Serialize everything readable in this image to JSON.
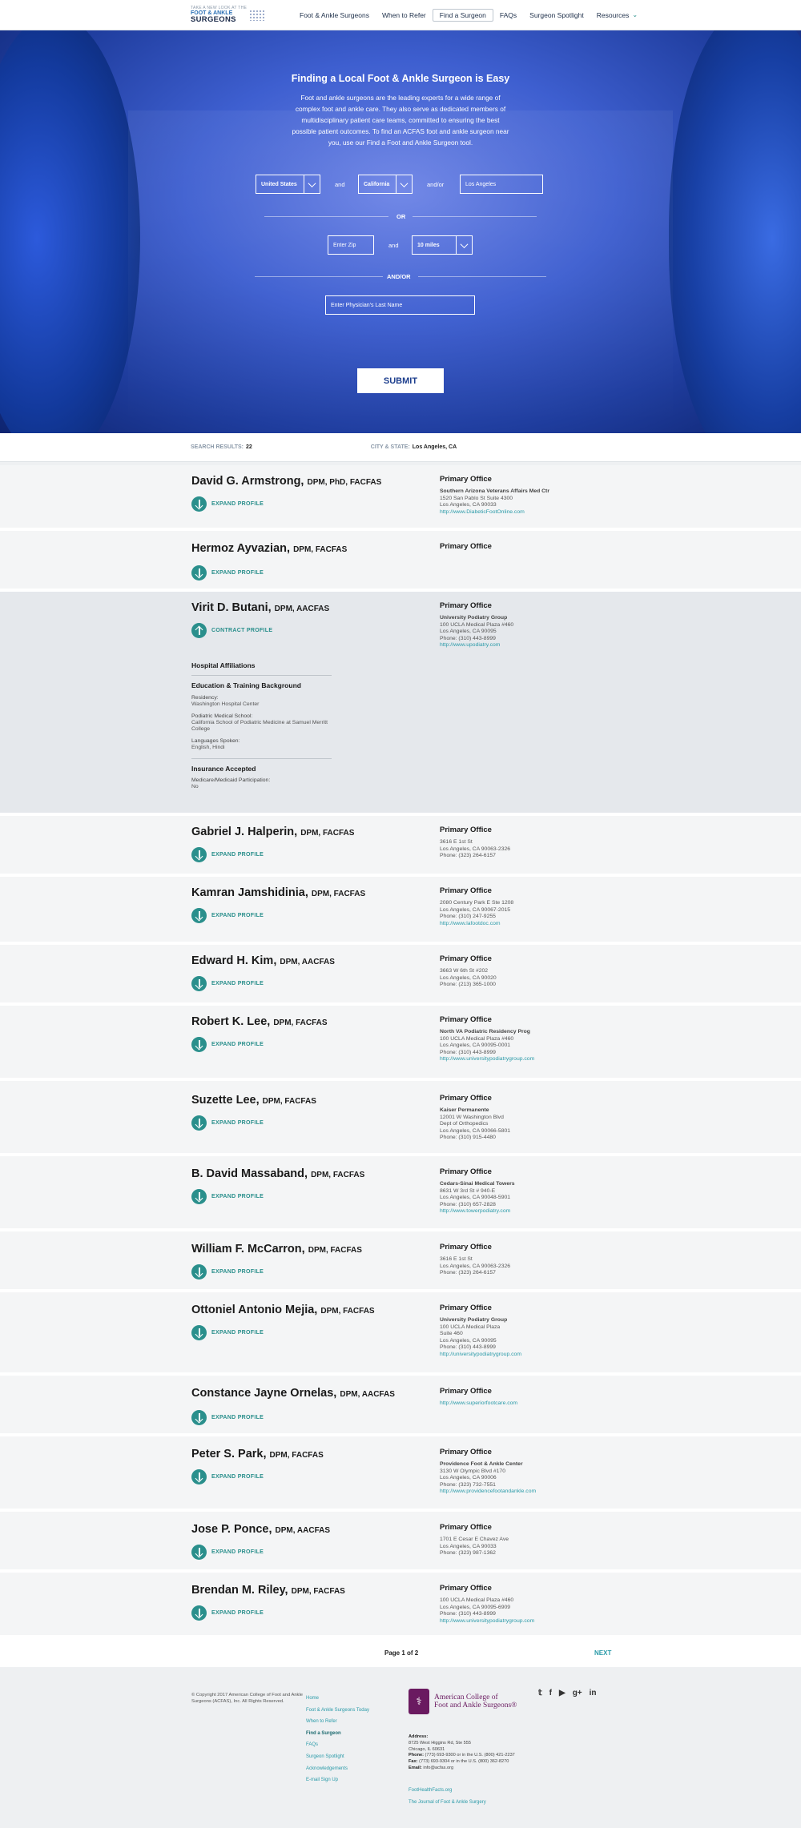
{
  "header": {
    "logo_tagline": "TAKE A NEW LOOK AT THE",
    "logo_line1": "FOOT & ANKLE",
    "logo_line2": "SURGEONS",
    "nav": [
      {
        "label": "Foot & Ankle Surgeons"
      },
      {
        "label": "When to Refer"
      },
      {
        "label": "Find a Surgeon"
      },
      {
        "label": "FAQs"
      },
      {
        "label": "Surgeon Spotlight"
      },
      {
        "label": "Resources"
      }
    ]
  },
  "hero": {
    "title": "Finding a Local Foot & Ankle Surgeon is Easy",
    "body": "Foot and ankle surgeons are the leading experts for a wide range of complex foot and ankle care. They also serve as dedicated members of multidisciplinary patient care teams, committed to ensuring the best possible patient outcomes. To find an ACFAS foot and ankle surgeon near you, use our Find a Foot and Ankle Surgeon tool.",
    "country": "United States",
    "and1": "and",
    "state": "California",
    "andor": "and/or",
    "city": "Los Angeles",
    "or": "OR",
    "zip_placeholder": "Enter Zip",
    "and2": "and",
    "radius": "10 miles",
    "andor2": "AND/OR",
    "lastname_placeholder": "Enter Physician's Last Name",
    "submit": "SUBMIT"
  },
  "results": {
    "count_label": "SEARCH RESULTS:",
    "count": "22",
    "city_label": "CITY & STATE:",
    "city": "Los Angeles, CA"
  },
  "surgeons": [
    {
      "name": "David G. Armstrong,",
      "creds": "DPM, PhD, FACFAS",
      "action": "EXPAND PROFILE",
      "office_heading": "Primary Office",
      "org": "Southern Arizona Veterans Affairs Med Ctr",
      "lines": [
        "1520 San Pablo St Suite 4300",
        "Los Angeles, CA 90033"
      ],
      "url": "http://www.DiabeticFootOnline.com"
    },
    {
      "name": "Hermoz Ayvazian,",
      "creds": "DPM, FACFAS",
      "action": "EXPAND PROFILE",
      "office_heading": "Primary Office",
      "org": "",
      "lines": [],
      "url": ""
    },
    {
      "name": "Virit D. Butani,",
      "creds": "DPM, AACFAS",
      "action": "CONTRACT PROFILE",
      "office_heading": "Primary Office",
      "org": "University Podiatry Group",
      "lines": [
        "100 UCLA Medical Plaza #460",
        "Los Angeles, CA 90095",
        "Phone: (310) 443-8999"
      ],
      "url": "http://www.upodiatry.com"
    },
    {
      "name": "Gabriel J. Halperin,",
      "creds": "DPM, FACFAS",
      "action": "EXPAND PROFILE",
      "office_heading": "Primary Office",
      "org": "",
      "lines": [
        "3616 E 1st St",
        "Los Angeles, CA 90063-2326",
        "Phone: (323) 264-6157"
      ],
      "url": ""
    },
    {
      "name": "Kamran Jamshidinia,",
      "creds": "DPM, FACFAS",
      "action": "EXPAND PROFILE",
      "office_heading": "Primary Office",
      "org": "",
      "lines": [
        "2080 Century Park E Ste 1208",
        "Los Angeles, CA 90067-2015",
        "Phone: (310) 247-9255"
      ],
      "url": "http://www.lafootdoc.com"
    },
    {
      "name": "Edward H. Kim,",
      "creds": "DPM, AACFAS",
      "action": "EXPAND PROFILE",
      "office_heading": "Primary Office",
      "org": "",
      "lines": [
        "3663 W 6th St #202",
        "Los Angeles, CA 90020",
        "Phone: (213) 365-1000"
      ],
      "url": ""
    },
    {
      "name": "Robert K. Lee,",
      "creds": "DPM, FACFAS",
      "action": "EXPAND PROFILE",
      "office_heading": "Primary Office",
      "org": "North VA Podiatric Residency Prog",
      "lines": [
        "100 UCLA Medical Plaza #460",
        "Los Angeles, CA 90095-0001",
        "Phone: (310) 443-8999"
      ],
      "url": "http://www.universitypodiatrygroup.com"
    },
    {
      "name": "Suzette Lee,",
      "creds": "DPM, FACFAS",
      "action": "EXPAND PROFILE",
      "office_heading": "Primary Office",
      "org": "Kaiser Permanente",
      "lines": [
        "12001 W Washington Blvd",
        "Dept of Orthopedics",
        "Los Angeles, CA 90066-5801",
        "Phone: (310) 915-4480"
      ],
      "url": ""
    },
    {
      "name": "B. David Massaband,",
      "creds": "DPM, FACFAS",
      "action": "EXPAND PROFILE",
      "office_heading": "Primary Office",
      "org": "Cedars-Sinai Medical Towers",
      "lines": [
        "8631 W 3rd St # 940-E",
        "Los Angeles, CA 90048-5901",
        "Phone: (310) 657-2828"
      ],
      "url": "http://www.towerpodiatry.com"
    },
    {
      "name": "William F. McCarron,",
      "creds": "DPM, FACFAS",
      "action": "EXPAND PROFILE",
      "office_heading": "Primary Office",
      "org": "",
      "lines": [
        "3616 E 1st St",
        "Los Angeles, CA 90063-2326",
        "Phone: (323) 264-6157"
      ],
      "url": ""
    },
    {
      "name": "Ottoniel Antonio Mejia,",
      "creds": "DPM, FACFAS",
      "action": "EXPAND PROFILE",
      "office_heading": "Primary Office",
      "org": "University Podiatry Group",
      "lines": [
        "100 UCLA Medical Plaza",
        "Suite 460",
        "Los Angeles, CA 90095",
        "Phone: (310) 443-8999"
      ],
      "url": "http://universitypodiatrygroup.com"
    },
    {
      "name": "Constance Jayne Ornelas,",
      "creds": "DPM, AACFAS",
      "action": "EXPAND PROFILE",
      "office_heading": "Primary Office",
      "org": "",
      "lines": [],
      "url": "http://www.superiorfootcare.com"
    },
    {
      "name": "Peter S. Park,",
      "creds": "DPM, FACFAS",
      "action": "EXPAND PROFILE",
      "office_heading": "Primary Office",
      "org": "Providence Foot & Ankle Center",
      "lines": [
        "3130 W Olympic Blvd #170",
        "Los Angeles, CA 90006",
        "Phone: (323) 732-7551"
      ],
      "url": "http://www.providencefootandankle.com"
    },
    {
      "name": "Jose P. Ponce,",
      "creds": "DPM, AACFAS",
      "action": "EXPAND PROFILE",
      "office_heading": "Primary Office",
      "org": "",
      "lines": [
        "1701 E Cesar E Chavez Ave",
        "Los Angeles, CA 90033",
        "Phone: (323) 987-1362"
      ],
      "url": ""
    },
    {
      "name": "Brendan M. Riley,",
      "creds": "DPM, FACFAS",
      "action": "EXPAND PROFILE",
      "office_heading": "Primary Office",
      "org": "",
      "lines": [
        "100 UCLA Medical Plaza #460",
        "Los Angeles, CA 90095-6909",
        "Phone: (310) 443-8999"
      ],
      "url": "http://www.universitypodiatrygroup.com"
    }
  ],
  "expanded": {
    "hospital": "Hospital Affiliations",
    "education": "Education & Training Background",
    "residency_label": "Residency:",
    "residency": "Washington Hospital Center",
    "school_label": "Podiatric Medical School:",
    "school": "California School of Podiatric Medicine at Samuel Merritt College",
    "lang_label": "Languages Spoken:",
    "lang": "English, Hindi",
    "insurance": "Insurance Accepted",
    "medicare_label": "Medicare/Medicaid Participation:",
    "medicare": "No"
  },
  "pager": {
    "label": "Page 1 of 2",
    "next": "NEXT"
  },
  "footer": {
    "copyright": "© Copyright 2017 American College of Foot and Ankle Surgeons (ACFAS), Inc. All Rights Reserved.",
    "links": [
      {
        "label": "Home"
      },
      {
        "label": "Foot & Ankle Surgeons Today"
      },
      {
        "label": "When to Refer"
      },
      {
        "label": "Find a Surgeon"
      },
      {
        "label": "FAQs"
      },
      {
        "label": "Surgeon Spotlight"
      },
      {
        "label": "Acknowledgements"
      },
      {
        "label": "E-mail Sign Up"
      }
    ],
    "org_name_line1": "American College of",
    "org_name_line2": "Foot and Ankle Surgeons®",
    "address_label": "Address:",
    "address1": "8725 West Higgins Rd, Ste 555",
    "address2": "Chicago, IL 60631",
    "phone_label": "Phone:",
    "phone": "(773) 693-9300 or in the U.S. (800) 421-2237",
    "fax_label": "Fax:",
    "fax": "(773) 693-9304 or in the U.S. (800) 362-8270",
    "email_label": "Email:",
    "email": "info@acfas.org",
    "extra_links": [
      {
        "label": "FootHealthFacts.org"
      },
      {
        "label": "The Journal of Foot & Ankle Surgery"
      }
    ],
    "social": [
      "twitter-icon",
      "facebook-icon",
      "youtube-icon",
      "google-plus-icon",
      "linkedin-icon"
    ]
  },
  "colors": {
    "accent": "#2a8f8c",
    "link": "#2a9aa8",
    "hero": "#3e5fd0",
    "brand": "#6a1a60"
  }
}
